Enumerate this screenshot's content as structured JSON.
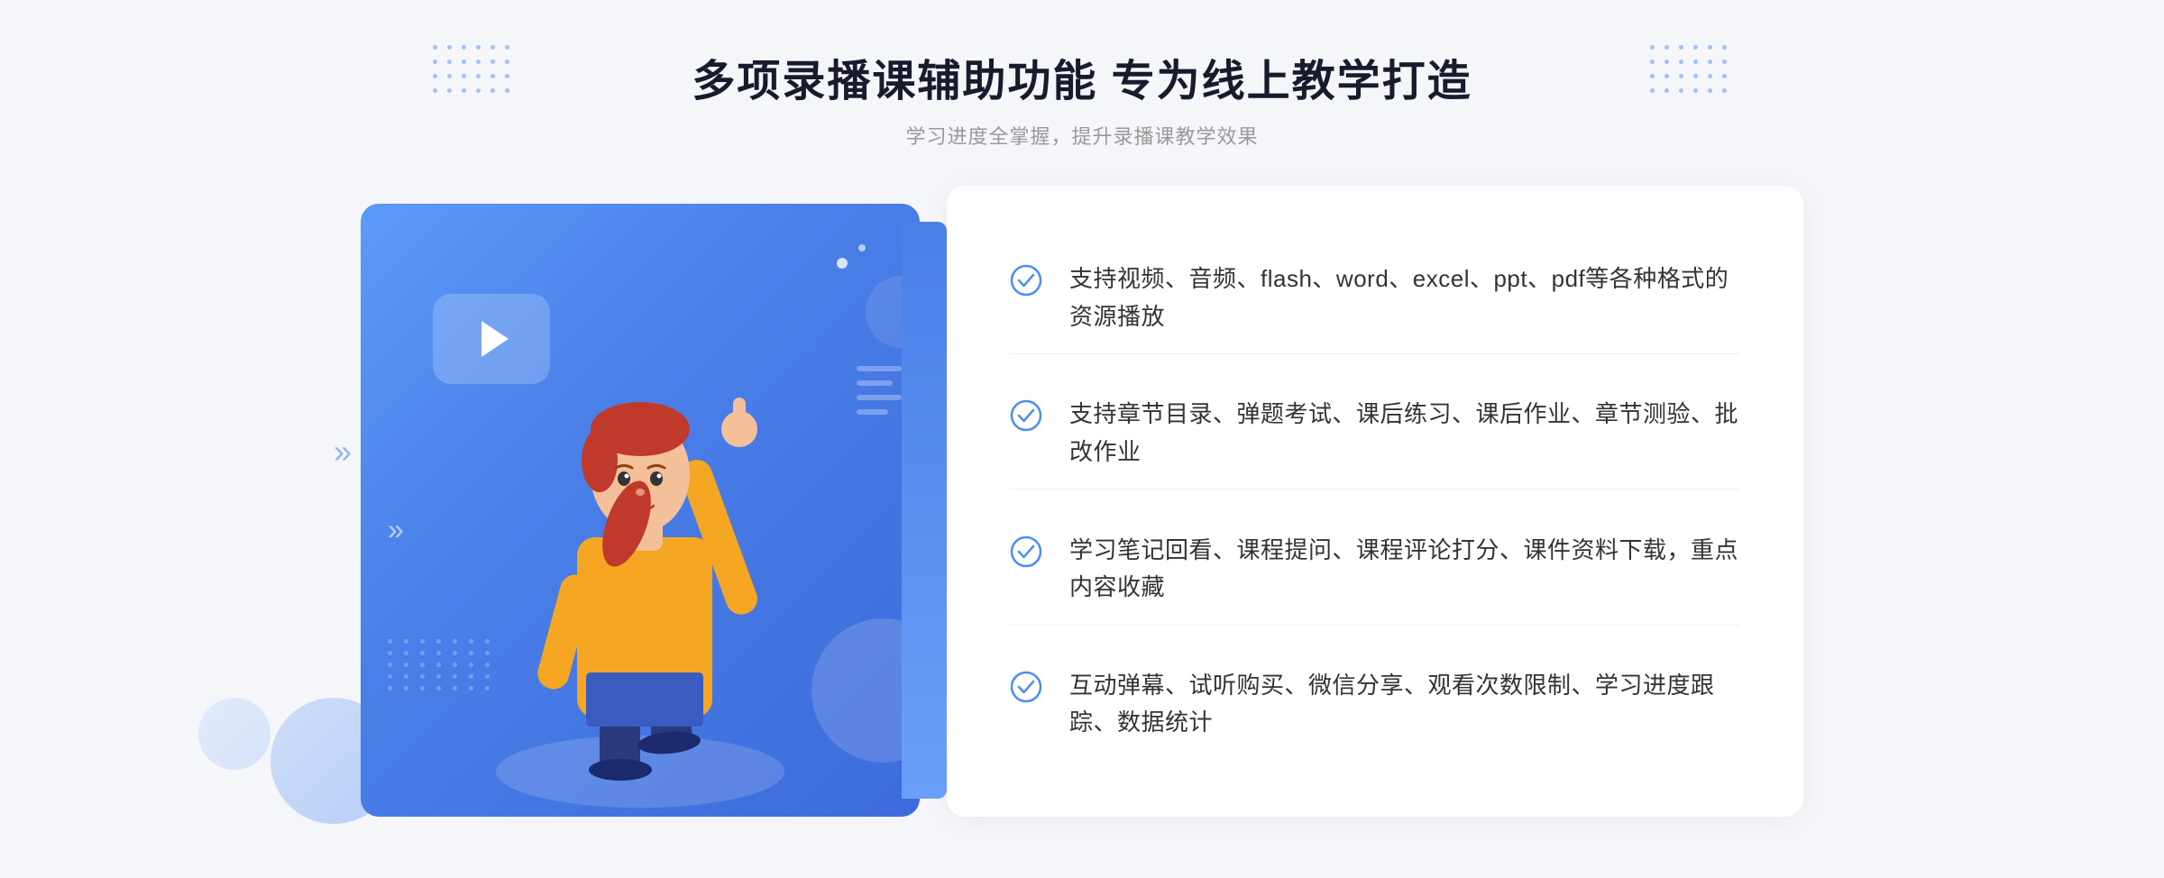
{
  "header": {
    "main_title": "多项录播课辅助功能 专为线上教学打造",
    "sub_title": "学习进度全掌握，提升录播课教学效果"
  },
  "features": [
    {
      "id": 1,
      "text": "支持视频、音频、flash、word、excel、ppt、pdf等各种格式的资源播放"
    },
    {
      "id": 2,
      "text": "支持章节目录、弹题考试、课后练习、课后作业、章节测验、批改作业"
    },
    {
      "id": 3,
      "text": "学习笔记回看、课程提问、课程评论打分、课件资料下载，重点内容收藏"
    },
    {
      "id": 4,
      "text": "互动弹幕、试听购买、微信分享、观看次数限制、学习进度跟踪、数据统计"
    }
  ],
  "colors": {
    "primary_blue": "#4d8ef0",
    "light_blue": "#7aa8f8",
    "dark_text": "#333333",
    "gray_text": "#999999",
    "white": "#ffffff",
    "bg": "#f5f6fa"
  },
  "icons": {
    "check": "check-circle-icon",
    "play": "play-icon",
    "chevron_left": "chevron-left-icon"
  }
}
